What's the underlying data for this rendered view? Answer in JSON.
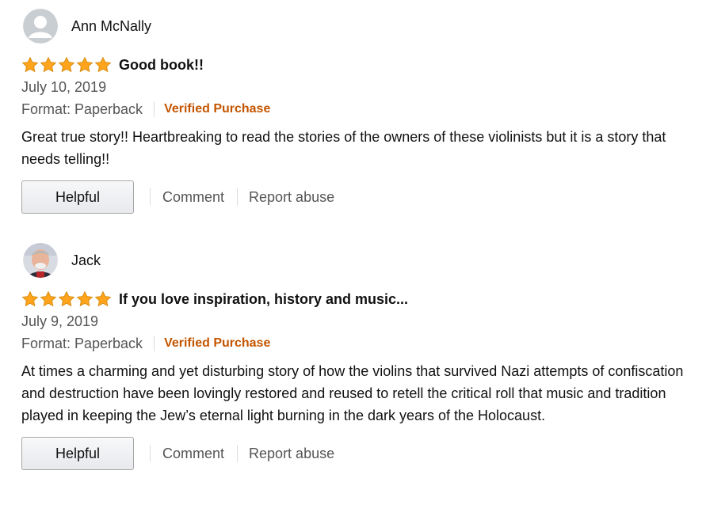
{
  "reviews": [
    {
      "reviewer": "Ann McNally",
      "avatar": "default-avatar",
      "rating": 5,
      "title": "Good book!!",
      "date": "July 10, 2019",
      "format": "Format: Paperback",
      "verified": "Verified Purchase",
      "body": "Great true story!! Heartbreaking to read the stories of the owners of these violinists but it is a story that needs telling!!",
      "helpful_label": "Helpful",
      "comment_label": "Comment",
      "report_label": "Report abuse"
    },
    {
      "reviewer": "Jack",
      "avatar": "photo-avatar",
      "rating": 5,
      "title": "If you love inspiration, history and music...",
      "date": "July 9, 2019",
      "format": "Format: Paperback",
      "verified": "Verified Purchase",
      "body": "At times a charming and yet disturbing story of how the violins that survived Nazi attempts of confiscation and destruction have been lovingly restored and reused to retell the critical roll that music and tradition played in keeping the Jew’s eternal light burning in the dark years of the Holocaust.",
      "helpful_label": "Helpful",
      "comment_label": "Comment",
      "report_label": "Report abuse"
    }
  ],
  "colors": {
    "star": "#ffa41c",
    "verified": "#c45500",
    "muted_text": "#555555"
  }
}
